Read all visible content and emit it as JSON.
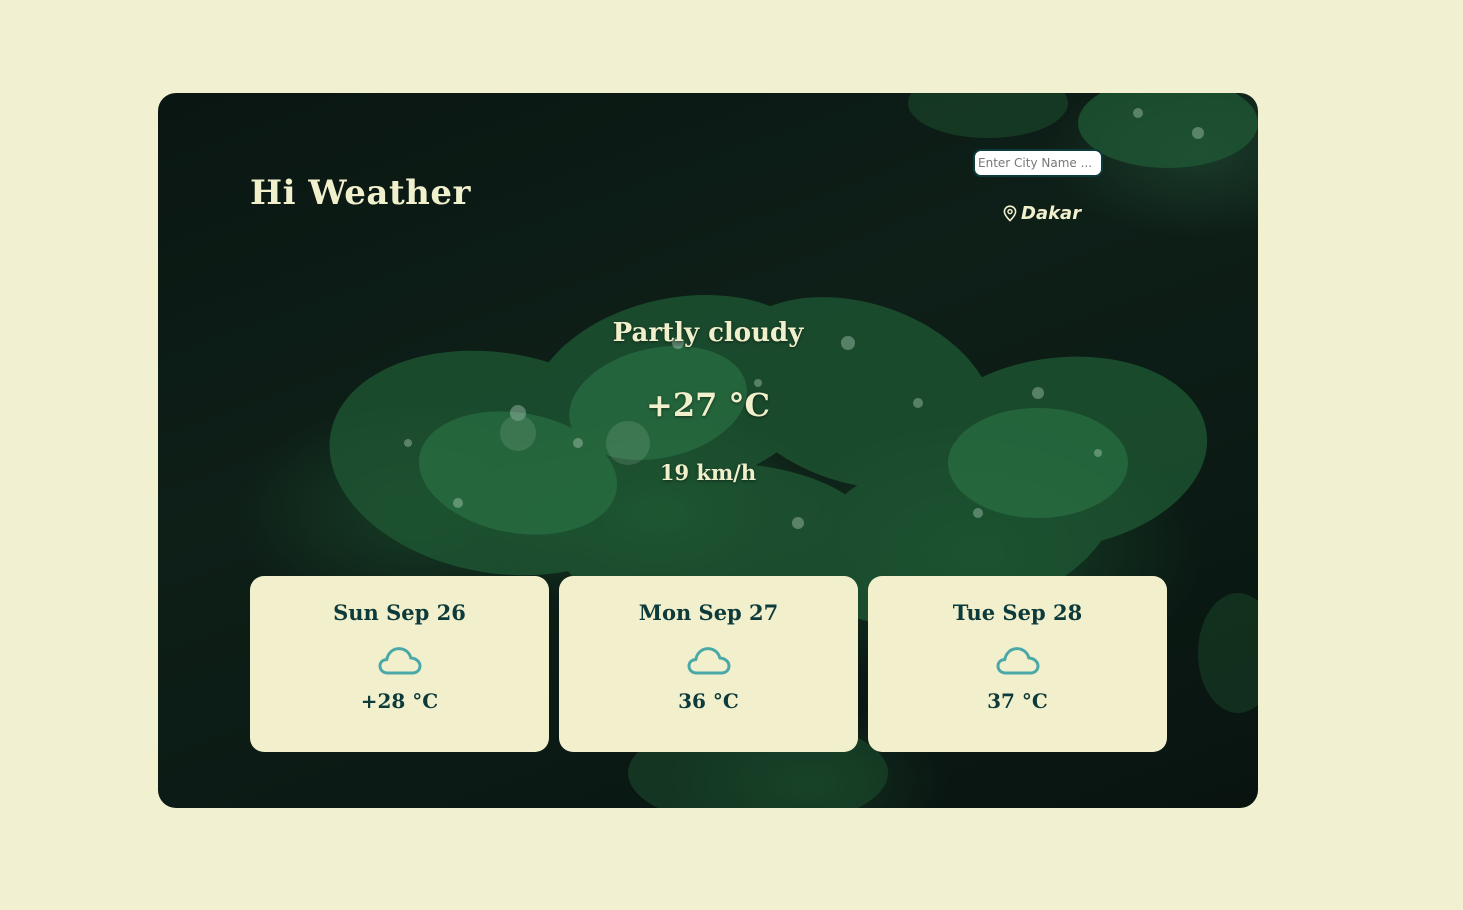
{
  "header": {
    "title": "Hi Weather"
  },
  "search": {
    "placeholder": "Enter City Name ...",
    "value": ""
  },
  "location": {
    "city": "Dakar",
    "icon": "map-pin-icon"
  },
  "current": {
    "condition": "Partly cloudy",
    "temperature": "+27 °C",
    "wind": "19 km/h"
  },
  "forecast": [
    {
      "day": "Sun Sep 26",
      "icon": "cloud-icon",
      "temperature": "+28 °C"
    },
    {
      "day": "Mon Sep 27",
      "icon": "cloud-icon",
      "temperature": "36 °C"
    },
    {
      "day": "Tue Sep 28",
      "icon": "cloud-icon",
      "temperature": "37 °C"
    }
  ],
  "colors": {
    "page_background": "#f1f0d0",
    "text_light": "#f1f0cc",
    "text_dark": "#0d3a3a",
    "icon_accent": "#4aa8a8",
    "forecast_card": "#f2f0cc"
  }
}
